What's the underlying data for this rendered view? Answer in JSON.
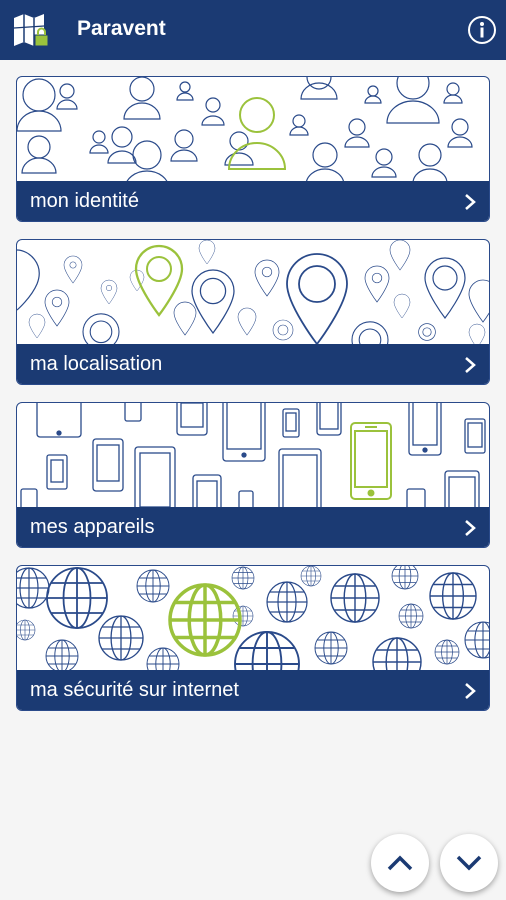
{
  "app": {
    "title": "Paravent"
  },
  "icons": {
    "logo": "folded-map-lock-icon",
    "info": "info-icon",
    "chevron": "chevron-right-icon",
    "scroll_up": "chevron-up-icon",
    "scroll_down": "chevron-down-icon"
  },
  "colors": {
    "primary": "#1b3a73",
    "accent": "#9bc23c",
    "outline": "#2a4a8a"
  },
  "cards": [
    {
      "label": "mon identité",
      "art": "people"
    },
    {
      "label": "ma localisation",
      "art": "pins"
    },
    {
      "label": "mes appareils",
      "art": "devices"
    },
    {
      "label": "ma sécurité sur internet",
      "art": "globes"
    }
  ]
}
